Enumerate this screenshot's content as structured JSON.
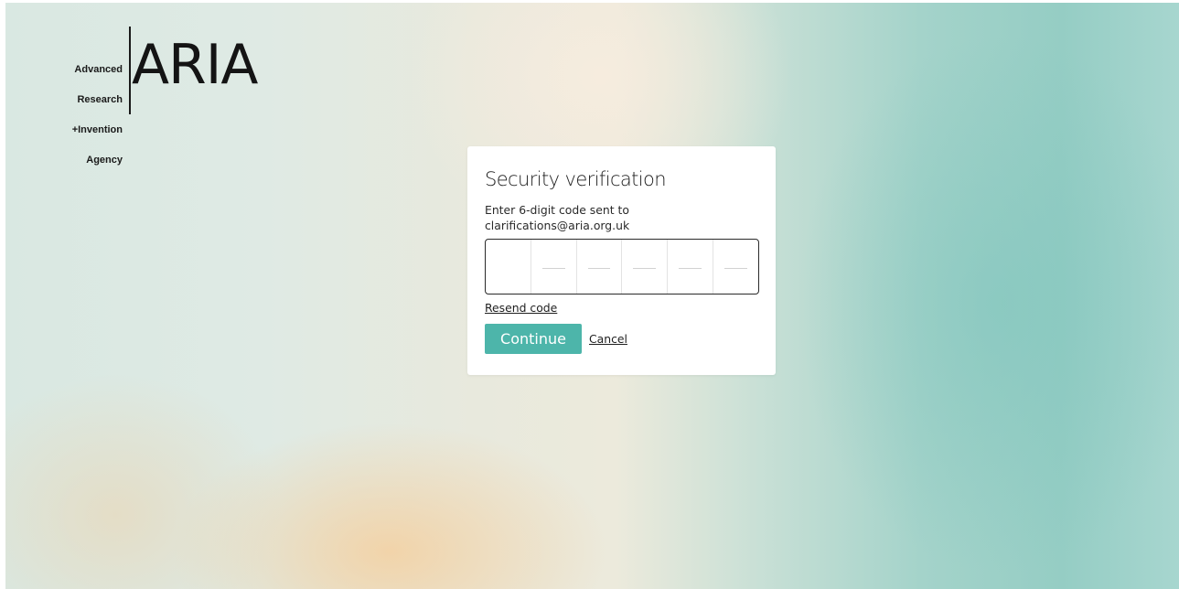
{
  "logo": {
    "small_lines": [
      "Advanced",
      "Research",
      "+Invention",
      "Agency"
    ],
    "wordmark": "ARIA"
  },
  "verification": {
    "title": "Security verification",
    "instruction": "Enter 6-digit code sent to",
    "email": "clarifications@aria.org.uk",
    "code_digits": [
      "",
      "",
      "",
      "",
      "",
      ""
    ],
    "resend_label": "Resend code",
    "continue_label": "Continue",
    "cancel_label": "Cancel"
  },
  "colors": {
    "accent": "#4db5aa",
    "text": "#1d1d1d",
    "card_background": "#ffffff"
  }
}
